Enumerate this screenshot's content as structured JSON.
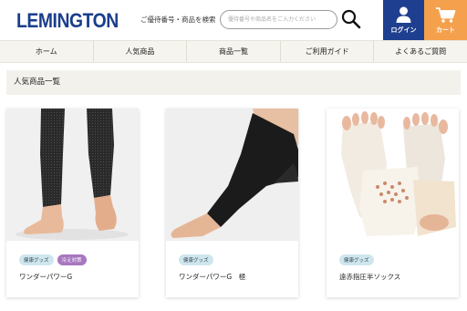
{
  "header": {
    "logo": "LEMINGTON",
    "search_label": "ご優待番号・商品を検索",
    "search_placeholder": "優待番号や商品名をご入力ください",
    "login_label": "ログイン",
    "cart_label": "カート",
    "colors": {
      "brand": "#1e3f8f",
      "cart": "#f5a04c"
    },
    "icons": [
      "search-icon",
      "user-icon",
      "cart-icon"
    ]
  },
  "nav": {
    "items": [
      {
        "label": "ホーム"
      },
      {
        "label": "人気商品"
      },
      {
        "label": "商品一覧"
      },
      {
        "label": "ご利用ガイド"
      },
      {
        "label": "よくあるご質問"
      }
    ]
  },
  "section": {
    "title": "人気商品一覧"
  },
  "products": [
    {
      "tags": [
        "健康グッズ",
        "冷え対策"
      ],
      "name": "ワンダーパワーG"
    },
    {
      "tags": [
        "健康グッズ"
      ],
      "name": "ワンダーパワーG　極"
    },
    {
      "tags": [
        "健康グッズ"
      ],
      "name": "遠赤指圧半ソックス"
    }
  ]
}
